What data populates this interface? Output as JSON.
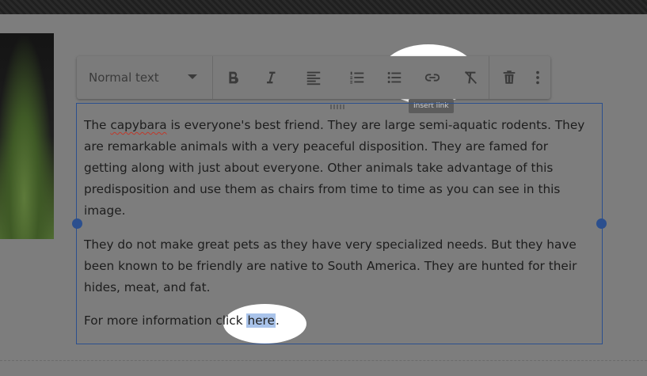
{
  "toolbar": {
    "text_style": "Normal text",
    "buttons": [
      {
        "name": "bold-icon"
      },
      {
        "name": "italic-icon"
      },
      {
        "name": "align-left-icon"
      },
      {
        "name": "numbered-list-icon"
      },
      {
        "name": "bulleted-list-icon"
      },
      {
        "name": "link-icon"
      },
      {
        "name": "clear-formatting-icon"
      },
      {
        "name": "delete-icon"
      },
      {
        "name": "more-options-icon"
      }
    ],
    "tooltip": "Insert link"
  },
  "content": {
    "p1_word": "capybara",
    "p1_before": "The ",
    "p1_after": " is everyone's best friend. They are large semi-aquatic rodents. They are remarkable animals with a very peaceful disposition. They are famed for getting along with just about everyone. Other animals take advantage of this predisposition and use them as chairs from time to time as you can see in this image.",
    "p2": "They do not make great pets as they have very specialized needs. But they have been known to be friendly are native to South America. They are hunted for their hides, meat, and fat.",
    "p3_before": "For more information click ",
    "p3_link": "here",
    "p3_after": "."
  },
  "colors": {
    "overlay": "#7d7d7d",
    "selection_border": "#2b4f8e",
    "link_highlight": "#a9c3ea"
  }
}
